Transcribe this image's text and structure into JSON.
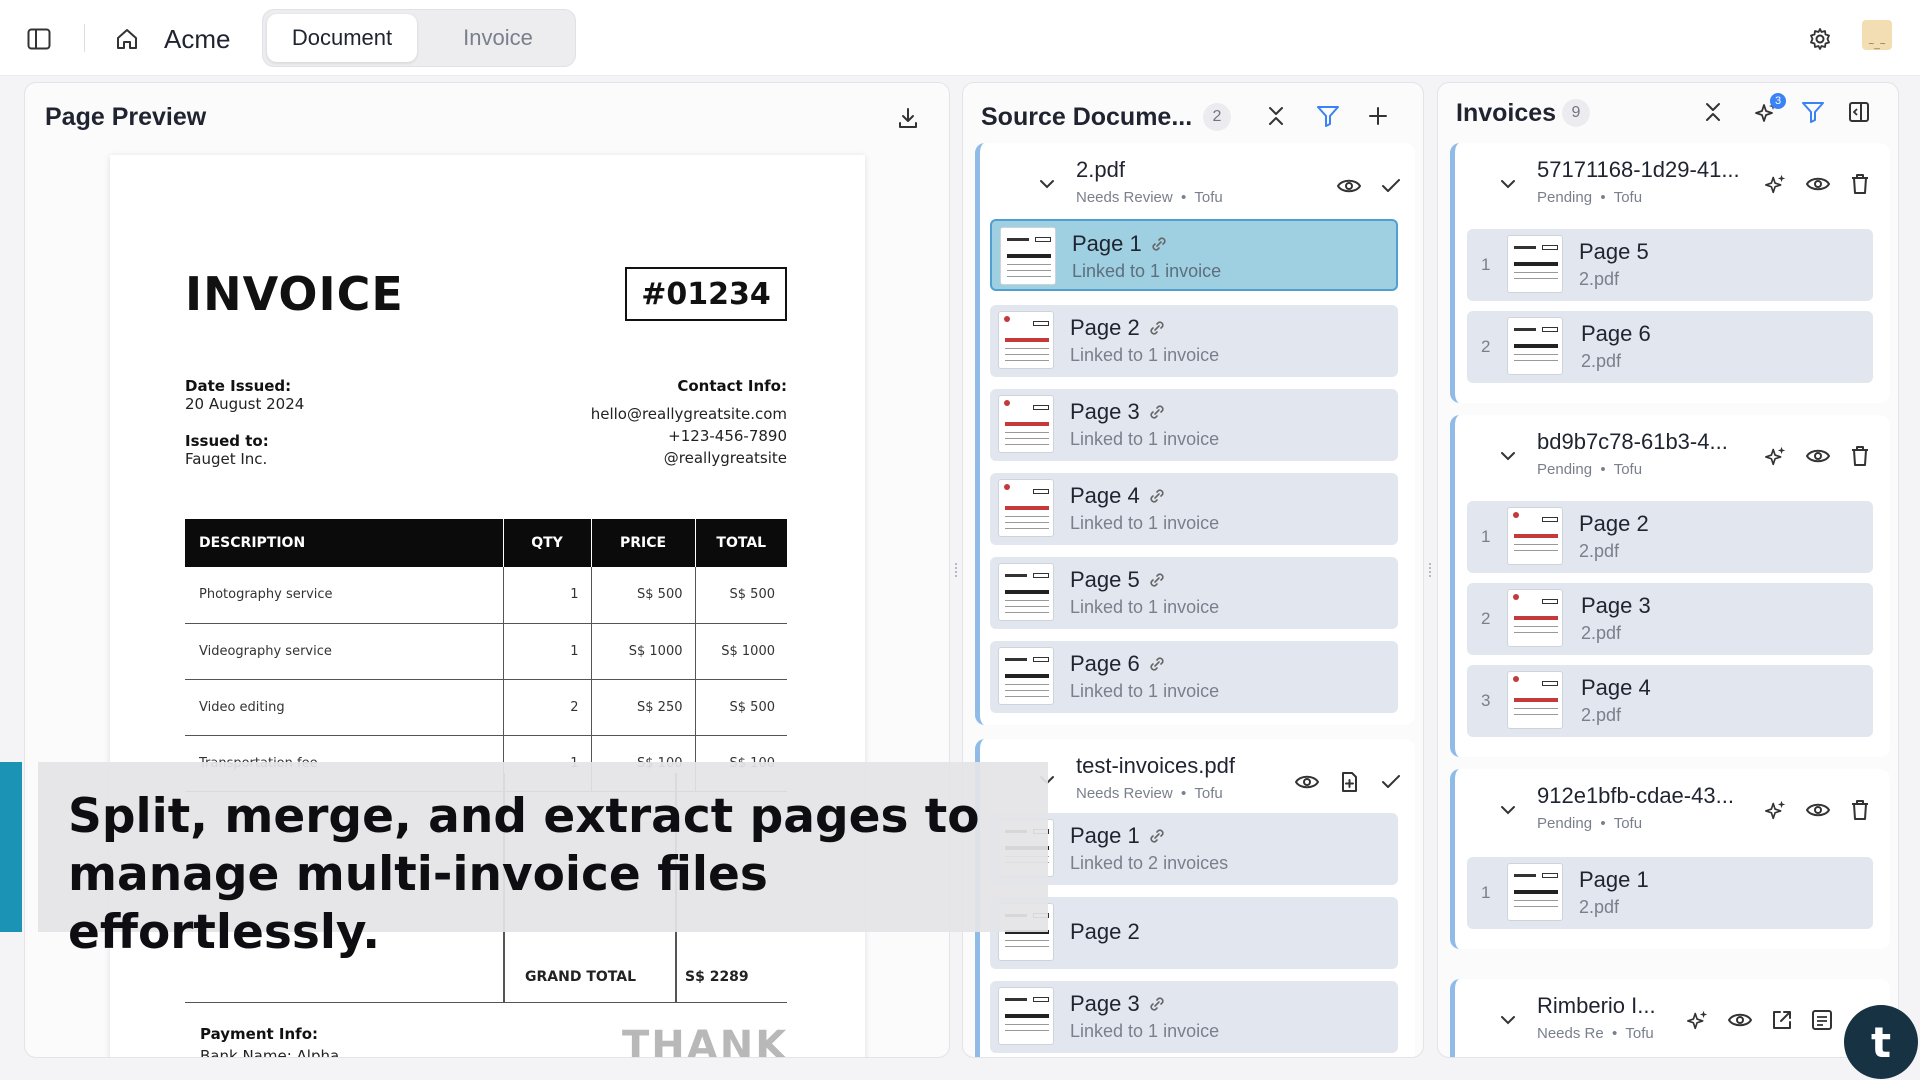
{
  "topbar": {
    "brand": "Acme",
    "tabs": [
      {
        "label": "Document",
        "active": true
      },
      {
        "label": "Invoice",
        "active": false
      }
    ],
    "avatar_text": "~_~"
  },
  "preview": {
    "title": "Page Preview",
    "invoice": {
      "heading": "INVOICE",
      "number": "#01234",
      "date_label": "Date Issued:",
      "date_value": "20 August 2024",
      "issued_label": "Issued to:",
      "issued_value": "Fauget Inc.",
      "contact_label": "Contact Info:",
      "contact_email": "hello@reallygreatsite.com",
      "contact_phone": "+123-456-7890",
      "contact_handle": "@reallygreatsite",
      "columns": [
        "DESCRIPTION",
        "QTY",
        "PRICE",
        "TOTAL"
      ],
      "rows": [
        [
          "Photography service",
          "1",
          "S$ 500",
          "S$ 500"
        ],
        [
          "Videography service",
          "1",
          "S$ 1000",
          "S$ 1000"
        ],
        [
          "Video editing",
          "2",
          "S$ 250",
          "S$ 500"
        ],
        [
          "Transportation fee",
          "1",
          "S$ 100",
          "S$ 100"
        ]
      ],
      "grand_label": "GRAND TOTAL",
      "grand_value": "S$ 2289",
      "payment_label": "Payment Info:",
      "bank_line": "Bank Name: Alpha",
      "thank": "THANK"
    }
  },
  "source": {
    "title": "Source Docume...",
    "count": "2",
    "groups": [
      {
        "name": "2.pdf",
        "status": "Needs Review",
        "owner": "Tofu",
        "pages": [
          {
            "label": "Page 1",
            "sub": "Linked to 1 invoice"
          },
          {
            "label": "Page 2",
            "sub": "Linked to 1 invoice"
          },
          {
            "label": "Page 3",
            "sub": "Linked to 1 invoice"
          },
          {
            "label": "Page 4",
            "sub": "Linked to 1 invoice"
          },
          {
            "label": "Page 5",
            "sub": "Linked to 1 invoice"
          },
          {
            "label": "Page 6",
            "sub": "Linked to 1 invoice"
          }
        ]
      },
      {
        "name": "test-invoices.pdf",
        "status": "Needs Review",
        "owner": "Tofu",
        "pages": [
          {
            "label": "Page 1",
            "sub": "Linked to 2 invoices"
          },
          {
            "label": "Page 2",
            "sub": ""
          },
          {
            "label": "Page 3",
            "sub": "Linked to 1 invoice"
          }
        ]
      }
    ]
  },
  "invoices": {
    "title": "Invoices",
    "count": "9",
    "badge": "3",
    "groups": [
      {
        "name": "57171168-1d29-41...",
        "status": "Pending",
        "owner": "Tofu",
        "pages": [
          {
            "idx": "1",
            "label": "Page 5",
            "file": "2.pdf"
          },
          {
            "idx": "2",
            "label": "Page 6",
            "file": "2.pdf"
          }
        ]
      },
      {
        "name": "bd9b7c78-61b3-4...",
        "status": "Pending",
        "owner": "Tofu",
        "pages": [
          {
            "idx": "1",
            "label": "Page 2",
            "file": "2.pdf"
          },
          {
            "idx": "2",
            "label": "Page 3",
            "file": "2.pdf"
          },
          {
            "idx": "3",
            "label": "Page 4",
            "file": "2.pdf"
          }
        ]
      },
      {
        "name": "912e1bfb-cdae-43...",
        "status": "Pending",
        "owner": "Tofu",
        "pages": [
          {
            "idx": "1",
            "label": "Page 1",
            "file": "2.pdf"
          }
        ]
      },
      {
        "name": "Rimberio I...",
        "status": "Needs Re",
        "owner": "Tofu",
        "pages": []
      }
    ]
  },
  "caption": "Split, merge, and extract pages to manage multi-invoice files effortlessly.",
  "fab_label": "t",
  "colors": {
    "accent": "#3b82f6",
    "selected": "#9fd0e2",
    "caption_accent": "#1b93b5"
  }
}
